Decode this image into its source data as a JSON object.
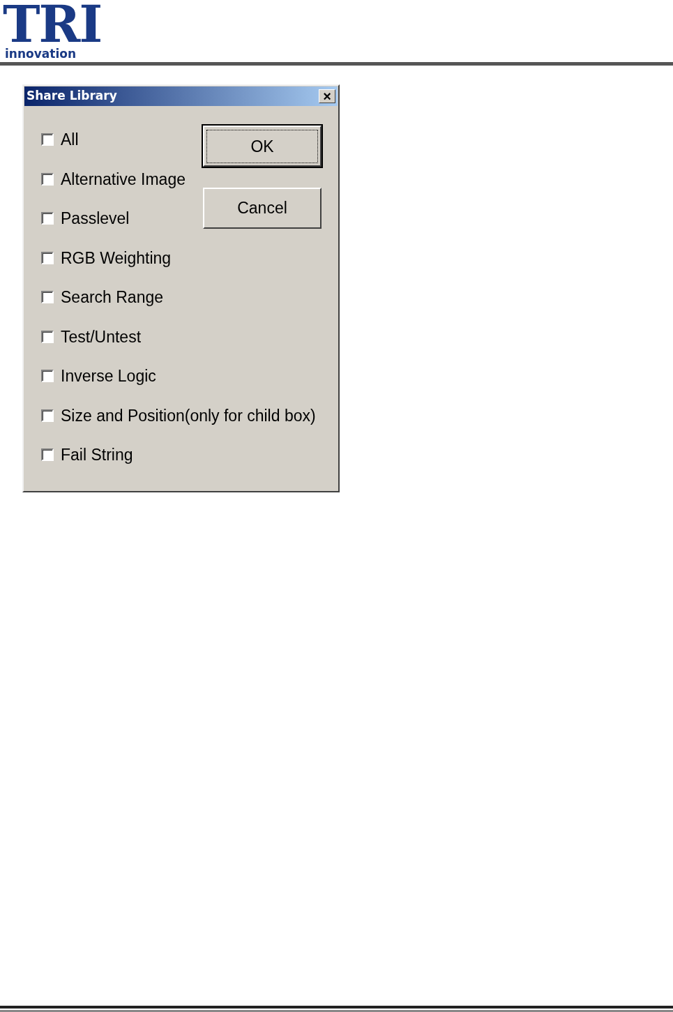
{
  "logo": {
    "mark": "TRI",
    "tagline": "innovation"
  },
  "dialog": {
    "title": "Share Library",
    "close": "×",
    "options": [
      {
        "label": "All",
        "checked": false
      },
      {
        "label": "Alternative Image",
        "checked": false
      },
      {
        "label": "Passlevel",
        "checked": false
      },
      {
        "label": "RGB Weighting",
        "checked": false
      },
      {
        "label": "Search Range",
        "checked": false
      },
      {
        "label": "Test/Untest",
        "checked": false
      },
      {
        "label": "Inverse Logic",
        "checked": false
      },
      {
        "label": "Size and Position(only for child box)",
        "checked": false
      },
      {
        "label": "Fail String",
        "checked": false
      }
    ],
    "buttons": [
      {
        "label": "OK",
        "default": true
      },
      {
        "label": "Cancel",
        "default": false
      }
    ]
  }
}
